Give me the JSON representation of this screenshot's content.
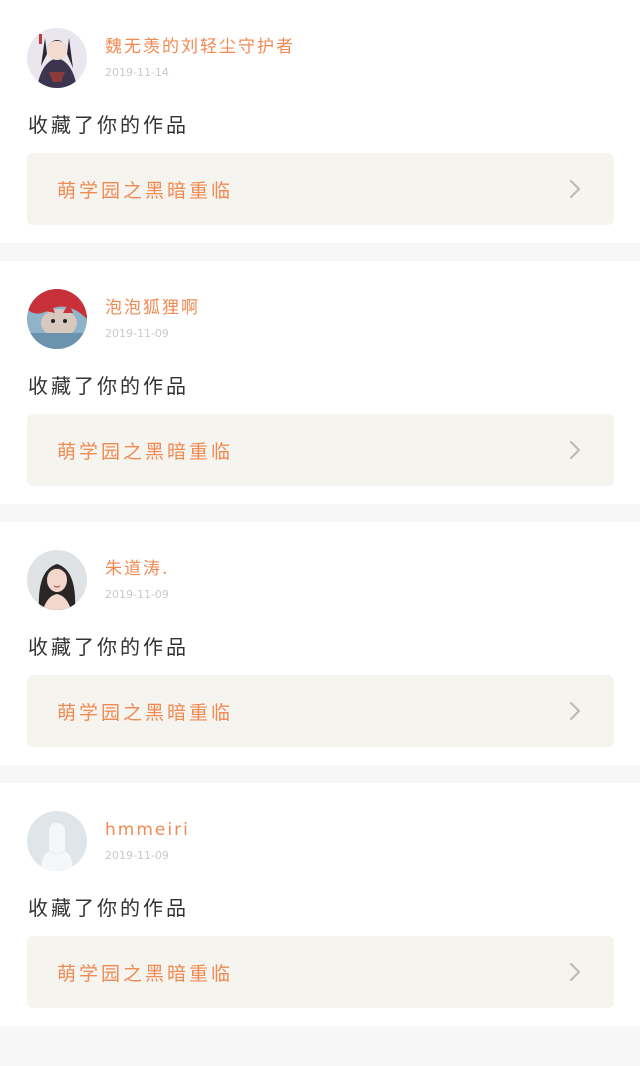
{
  "feed": {
    "items": [
      {
        "username": "魏无羡的刘轻尘守护者",
        "timestamp": "2019-11-14",
        "action": "收藏了你的作品",
        "work_title": "萌学园之黑暗重临",
        "avatar_icon": "anime-character-avatar"
      },
      {
        "username": "泡泡狐狸啊",
        "timestamp": "2019-11-09",
        "action": "收藏了你的作品",
        "work_title": "萌学园之黑暗重临",
        "avatar_icon": "red-plush-avatar"
      },
      {
        "username": "朱道涛.",
        "timestamp": "2019-11-09",
        "action": "收藏了你的作品",
        "work_title": "萌学园之黑暗重临",
        "avatar_icon": "portrait-photo-avatar"
      },
      {
        "username": "hmmeiri",
        "timestamp": "2019-11-09",
        "action": "收藏了你的作品",
        "work_title": "萌学园之黑暗重临",
        "avatar_icon": "default-user-avatar"
      }
    ]
  },
  "colors": {
    "accent": "#f08a53",
    "action_text": "#333333",
    "timestamp": "#c9c9c9",
    "link_bg": "#f5f4ef",
    "divider_bg": "#f7f7f7",
    "chevron": "#bbbbbb"
  }
}
